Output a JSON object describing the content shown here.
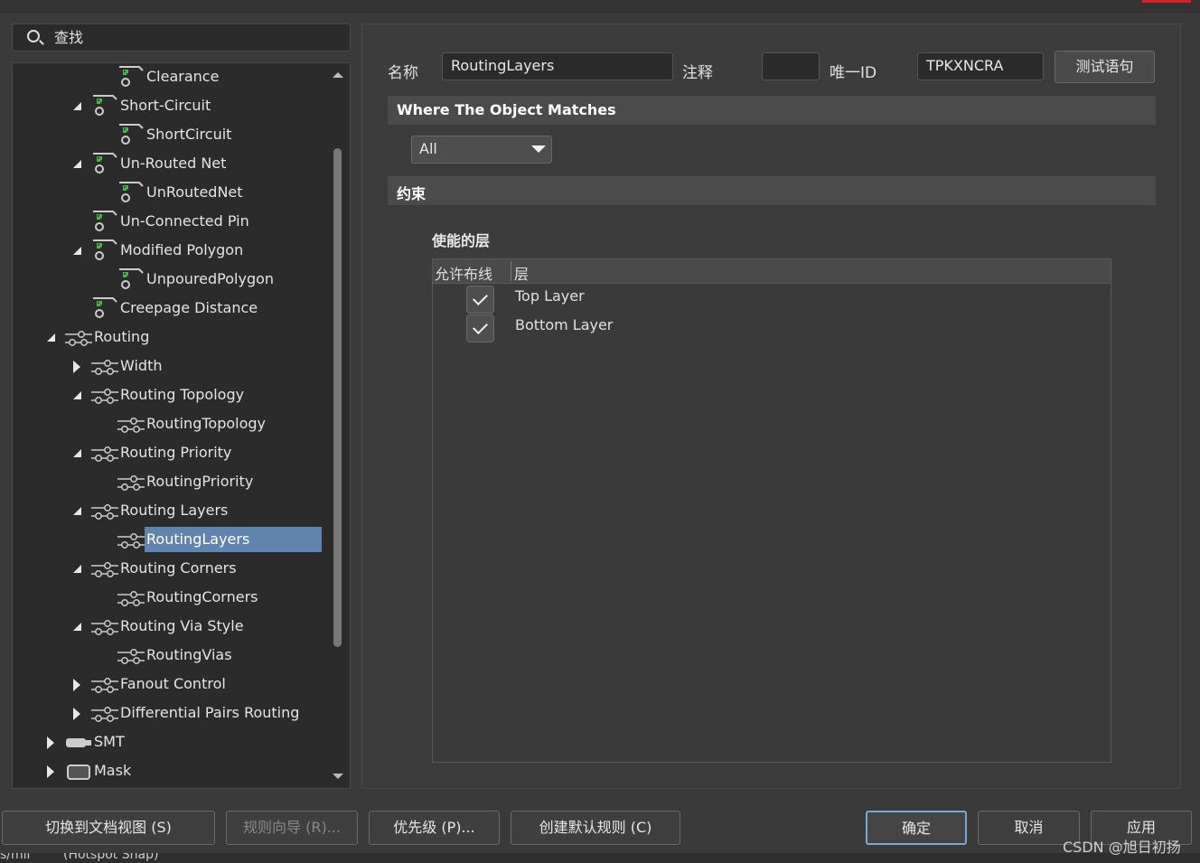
{
  "search": {
    "placeholder": "查找"
  },
  "tree": {
    "items": [
      {
        "label": "Clearance",
        "indent": 2,
        "expander": "none",
        "icon": "rule-icon"
      },
      {
        "label": "Short-Circuit",
        "indent": 1,
        "expander": "open",
        "icon": "rule-icon"
      },
      {
        "label": "ShortCircuit",
        "indent": 2,
        "expander": "none",
        "icon": "rule-icon"
      },
      {
        "label": "Un-Routed Net",
        "indent": 1,
        "expander": "open",
        "icon": "rule-icon"
      },
      {
        "label": "UnRoutedNet",
        "indent": 2,
        "expander": "none",
        "icon": "rule-icon"
      },
      {
        "label": "Un-Connected Pin",
        "indent": 1,
        "expander": "none",
        "icon": "rule-icon"
      },
      {
        "label": "Modified Polygon",
        "indent": 1,
        "expander": "open",
        "icon": "rule-icon"
      },
      {
        "label": "UnpouredPolygon",
        "indent": 2,
        "expander": "none",
        "icon": "rule-icon"
      },
      {
        "label": "Creepage Distance",
        "indent": 1,
        "expander": "none",
        "icon": "rule-icon"
      },
      {
        "label": "Routing",
        "indent": 0,
        "expander": "open",
        "icon": "routing-icon"
      },
      {
        "label": "Width",
        "indent": 1,
        "expander": "closed",
        "icon": "routing-icon"
      },
      {
        "label": "Routing Topology",
        "indent": 1,
        "expander": "open",
        "icon": "routing-icon"
      },
      {
        "label": "RoutingTopology",
        "indent": 2,
        "expander": "none",
        "icon": "routing-icon"
      },
      {
        "label": "Routing Priority",
        "indent": 1,
        "expander": "open",
        "icon": "routing-icon"
      },
      {
        "label": "RoutingPriority",
        "indent": 2,
        "expander": "none",
        "icon": "routing-icon"
      },
      {
        "label": "Routing Layers",
        "indent": 1,
        "expander": "open",
        "icon": "routing-icon"
      },
      {
        "label": "RoutingLayers",
        "indent": 2,
        "expander": "none",
        "icon": "routing-icon",
        "selected": true
      },
      {
        "label": "Routing Corners",
        "indent": 1,
        "expander": "open",
        "icon": "routing-icon"
      },
      {
        "label": "RoutingCorners",
        "indent": 2,
        "expander": "none",
        "icon": "routing-icon"
      },
      {
        "label": "Routing Via Style",
        "indent": 1,
        "expander": "open",
        "icon": "routing-icon"
      },
      {
        "label": "RoutingVias",
        "indent": 2,
        "expander": "none",
        "icon": "routing-icon"
      },
      {
        "label": "Fanout Control",
        "indent": 1,
        "expander": "closed",
        "icon": "routing-icon"
      },
      {
        "label": "Differential Pairs Routing",
        "indent": 1,
        "expander": "closed",
        "icon": "routing-icon"
      },
      {
        "label": "SMT",
        "indent": 0,
        "expander": "closed",
        "icon": "smt-icon"
      },
      {
        "label": "Mask",
        "indent": 0,
        "expander": "closed",
        "icon": "mask-icon"
      }
    ]
  },
  "form": {
    "name_label": "名称",
    "name_value": "RoutingLayers",
    "comment_label": "注释",
    "comment_value": "",
    "uid_label": "唯一ID",
    "uid_value": "TPKXNCRA",
    "test_button": "测试语句"
  },
  "where": {
    "header": "Where The Object Matches",
    "selected": "All"
  },
  "constraints": {
    "header": "约束",
    "subheader": "使能的层",
    "col_allow": "允许布线",
    "col_layer": "层",
    "layers": [
      {
        "name": "Top Layer",
        "checked": true
      },
      {
        "name": "Bottom Layer",
        "checked": true
      }
    ]
  },
  "footer": {
    "switch_view": "切换到文档视图 (S)",
    "rule_wizard": "规则向导 (R)...",
    "priority": "优先级 (P)...",
    "create_default": "创建默认规则 (C)",
    "ok": "确定",
    "cancel": "取消",
    "apply": "应用"
  },
  "statusbar": {
    "left": "s/mil",
    "snap": "(Hotspot Snap)"
  },
  "watermark": "CSDN @旭日初扬",
  "colors": {
    "background": "#3a3a3a",
    "selection": "#5f84ad",
    "accent_border": "#7aa7d6",
    "rule_icon_green": "#4caf50"
  }
}
